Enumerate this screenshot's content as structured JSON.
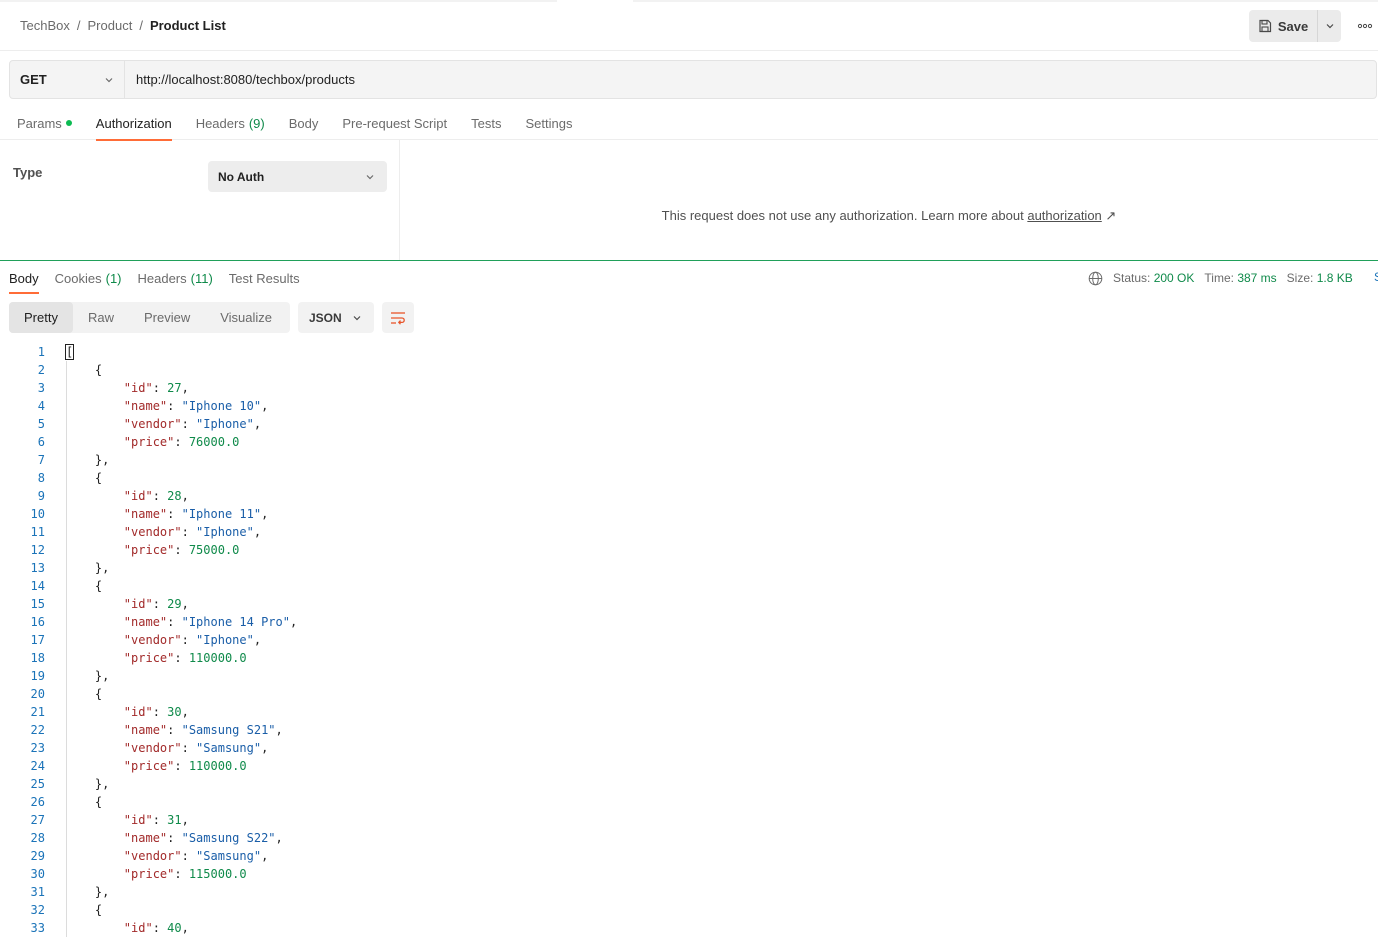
{
  "breadcrumb": [
    "TechBox",
    "Product",
    "Product List"
  ],
  "toolbar": {
    "save_label": "Save"
  },
  "request": {
    "method": "GET",
    "url": "http://localhost:8080/techbox/products"
  },
  "request_tabs": {
    "params": "Params",
    "authorization": "Authorization",
    "headers": "Headers",
    "headers_count": "(9)",
    "body": "Body",
    "pre_request": "Pre-request Script",
    "tests": "Tests",
    "settings": "Settings",
    "active": "Authorization"
  },
  "auth": {
    "type_label": "Type",
    "type_value": "No Auth",
    "message": "This request does not use any authorization. Learn more about ",
    "link_text": "authorization",
    "link_arrow": "↗"
  },
  "response_tabs": {
    "body": "Body",
    "cookies": "Cookies",
    "cookies_count": "(1)",
    "headers": "Headers",
    "headers_count": "(11)",
    "test_results": "Test Results",
    "active": "Body"
  },
  "response_status": {
    "status_label": "Status:",
    "status_value": "200 OK",
    "time_label": "Time:",
    "time_value": "387 ms",
    "size_label": "Size:",
    "size_value": "1.8 KB",
    "edge_text": "S"
  },
  "view_modes": {
    "pretty": "Pretty",
    "raw": "Raw",
    "preview": "Preview",
    "visualize": "Visualize",
    "active": "Pretty"
  },
  "format": "JSON",
  "response_body": [
    {
      "id": "27",
      "name": "\"Iphone 10\"",
      "vendor": "\"Iphone\"",
      "price": "76000.0"
    },
    {
      "id": "28",
      "name": "\"Iphone 11\"",
      "vendor": "\"Iphone\"",
      "price": "75000.0"
    },
    {
      "id": "29",
      "name": "\"Iphone 14 Pro\"",
      "vendor": "\"Iphone\"",
      "price": "110000.0"
    },
    {
      "id": "30",
      "name": "\"Samsung S21\"",
      "vendor": "\"Samsung\"",
      "price": "110000.0"
    },
    {
      "id": "31",
      "name": "\"Samsung S22\"",
      "vendor": "\"Samsung\"",
      "price": "115000.0"
    },
    {
      "id": "40"
    }
  ],
  "colors": {
    "accent": "#ff6c37",
    "success": "#0f8a4a",
    "line_number": "#1a73b8",
    "json_key": "#a22a2a",
    "json_string": "#1a5ea8",
    "json_number": "#0f8a4a"
  },
  "icons": {
    "save": "save-icon",
    "caret": "chevron-down-icon",
    "more": "more-horizontal-icon",
    "globe": "globe-icon",
    "wrap": "wrap-lines-icon"
  }
}
